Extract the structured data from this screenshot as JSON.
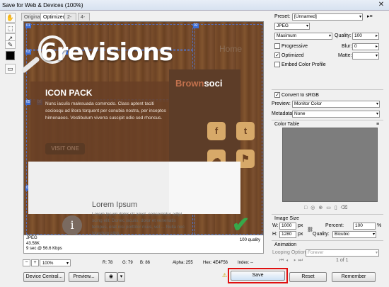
{
  "window": {
    "title": "Save for Web & Devices (100%)",
    "close_label": "✕"
  },
  "tools": [
    "✋",
    "⬚",
    "↗",
    "✎"
  ],
  "tabs": [
    "Original",
    "Optimized",
    "2-Up",
    "4-Up"
  ],
  "canvas": {
    "slice_tags": [
      "01",
      "02",
      "03",
      "04",
      "05",
      "06",
      "07"
    ],
    "logo": "6revisions",
    "home": "Home",
    "icon_pack_title": "ICON PACK",
    "icon_pack_body": "Nunc iaculis malesuada commodo. Class aptent taciti sociosqu ad litora torquent per conubia nostra, per inceptos himenaeos. Vestibulum viverra suscipit odio sed rhoncus.",
    "visit_button": "VISIT ONE",
    "brown_social_prefix": "Brown",
    "brown_social_suffix": "soci",
    "social_icons": [
      "f",
      "t",
      "☁",
      "⚑"
    ],
    "lorem_title": "Lorem Ipsum",
    "lorem_body": "Lorem ipsum dolor sit amet, consectetur adipi-scing elit. Donec iaculis, dolor et venenatis tempus, erat nisi porttitor risus, vel ... Nulla nec interdum nibh.",
    "info_glyph": "i",
    "check_glyph": "✔"
  },
  "infobar": {
    "format": "JPEG",
    "size": "43.58K",
    "time": "9 sec @ 56.6 Kbps",
    "quality": "100 quality"
  },
  "status": {
    "zoom": "100%",
    "r": "R: 78",
    "g": "G: 79",
    "b": "B: 86",
    "alpha": "Alpha: 255",
    "hex": "Hex: 4E4F56",
    "index": "Index: --"
  },
  "buttons": {
    "device_central": "Device Central...",
    "preview": "Preview...",
    "save": "Save",
    "reset": "Reset",
    "remember": "Remember"
  },
  "panel": {
    "preset_label": "Preset:",
    "preset_value": "[Unnamed]",
    "format_value": "JPEG",
    "quality_level": "Maximum",
    "quality_label": "Quality:",
    "quality_value": "100",
    "progressive": "Progressive",
    "blur_label": "Blur:",
    "blur_value": "0",
    "optimized": "Optimized",
    "matte_label": "Matte:",
    "embed_profile": "Embed Color Profile",
    "convert_srgb": "Convert to sRGB",
    "preview_label": "Preview:",
    "preview_value": "Monitor Color",
    "metadata_label": "Metadata:",
    "metadata_value": "None",
    "color_table": "Color Table",
    "image_size": "Image Size",
    "w_label": "W:",
    "w_value": "1000",
    "h_label": "H:",
    "h_value": "1280",
    "px": "px",
    "percent_label": "Percent:",
    "percent_value": "100",
    "percent_unit": "%",
    "quality2_label": "Quality:",
    "quality2_value": "Bicubic",
    "animation": "Animation",
    "looping_label": "Looping Options:",
    "looping_value": "Forever",
    "frames": "1 of 1"
  }
}
